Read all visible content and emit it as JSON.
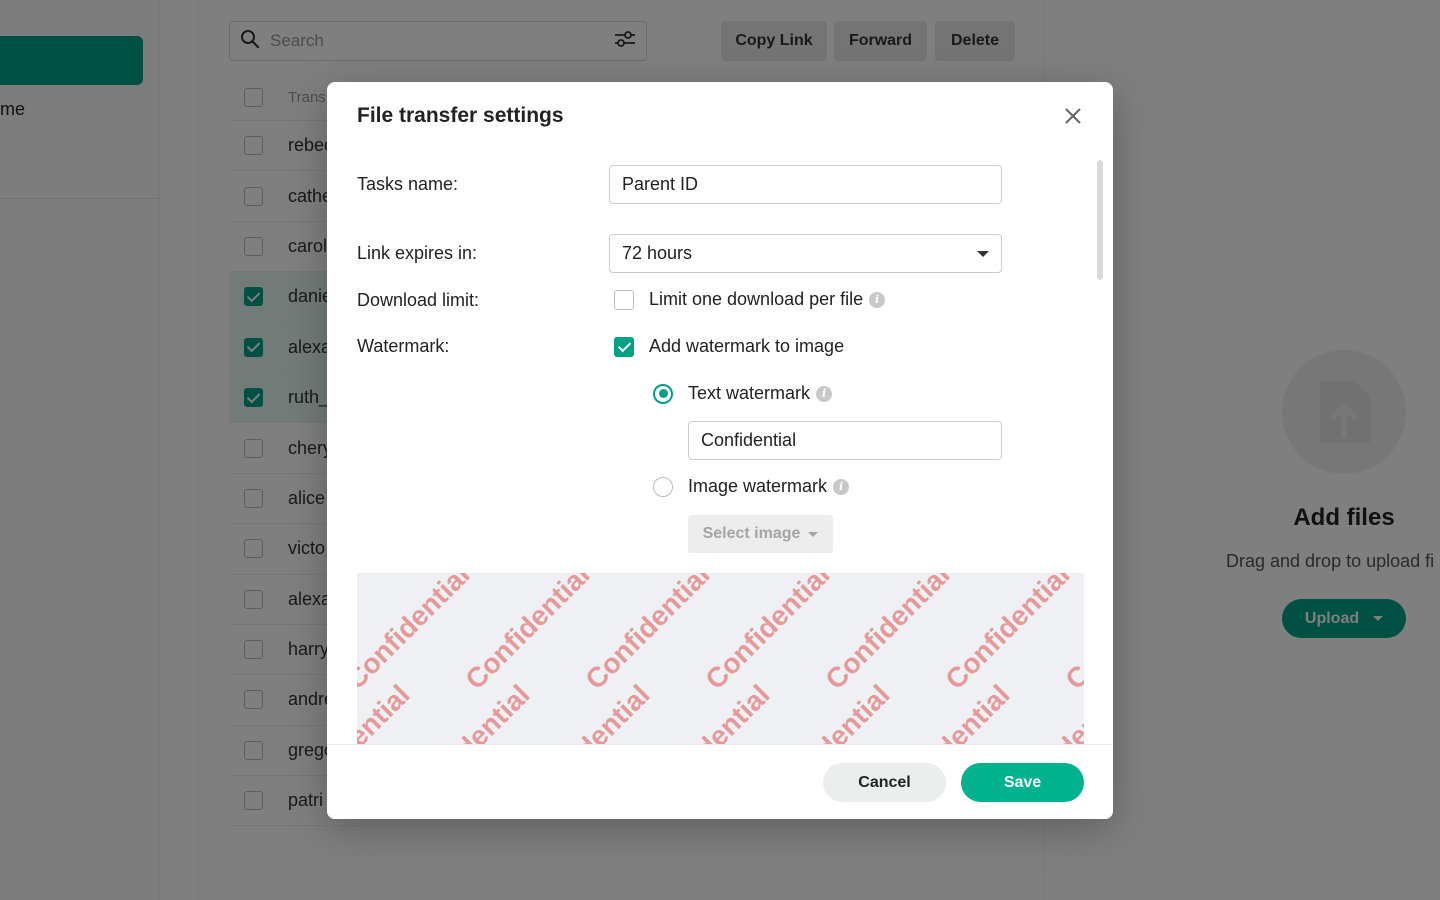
{
  "sidebar": {
    "nav_home_label": "me"
  },
  "toolbar": {
    "search_placeholder": "Search",
    "copy_link_label": "Copy Link",
    "forward_label": "Forward",
    "delete_label": "Delete"
  },
  "file_list": {
    "header": "Trans",
    "rows": [
      {
        "name": "rebec",
        "checked": false
      },
      {
        "name": "cathe",
        "checked": false
      },
      {
        "name": "carol",
        "checked": false
      },
      {
        "name": "danie",
        "checked": true
      },
      {
        "name": "alexa",
        "checked": true
      },
      {
        "name": "ruth_",
        "checked": true
      },
      {
        "name": "chery",
        "checked": false
      },
      {
        "name": "alice",
        "checked": false
      },
      {
        "name": "victo",
        "checked": false
      },
      {
        "name": "alexa",
        "checked": false
      },
      {
        "name": "harry",
        "checked": false
      },
      {
        "name": "andre",
        "checked": false
      },
      {
        "name": "grego",
        "checked": false
      },
      {
        "name": "patri",
        "checked": false
      }
    ]
  },
  "upload_panel": {
    "title": "Add files",
    "subtitle": "Drag and drop to upload fi",
    "upload_label": "Upload"
  },
  "modal": {
    "title": "File transfer settings",
    "task_name_label": "Tasks name:",
    "task_name_value": "Parent ID",
    "link_expires_label": "Link expires in:",
    "link_expires_value": "72 hours",
    "download_limit_label": "Download limit:",
    "download_limit_option": "Limit one download per file",
    "download_limit_checked": false,
    "watermark_label": "Watermark:",
    "watermark_option": "Add watermark to image",
    "watermark_checked": true,
    "text_watermark_label": "Text watermark",
    "text_watermark_selected": true,
    "text_watermark_value": "Confidential",
    "image_watermark_label": "Image watermark",
    "image_watermark_selected": false,
    "select_image_label": "Select image",
    "preview_text": "Confidential",
    "cancel_label": "Cancel",
    "save_label": "Save"
  },
  "colors": {
    "accent": "#00a286",
    "save_button": "#00b38e",
    "watermark_text": "#e59a9a",
    "preview_bg": "#eff0f3"
  }
}
